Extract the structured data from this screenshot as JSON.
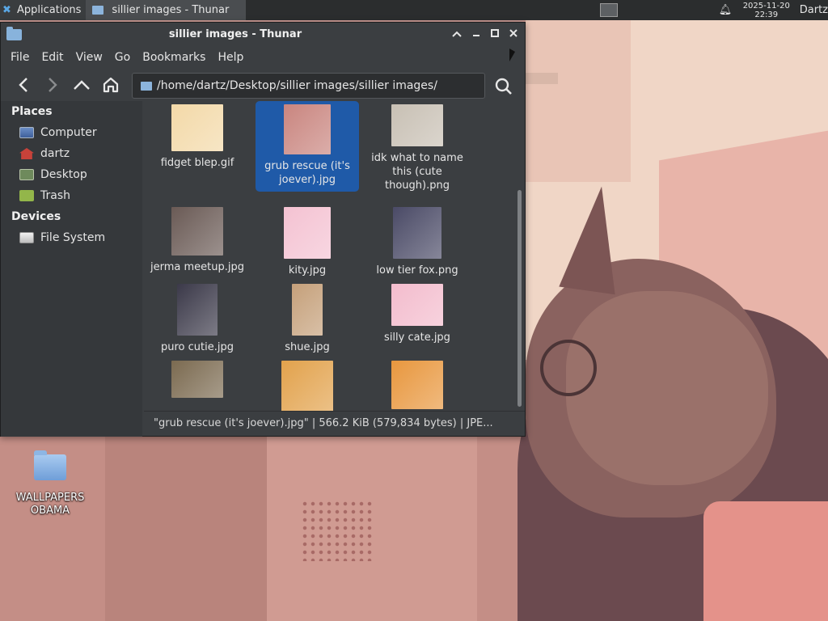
{
  "panel": {
    "apps_label": "Applications",
    "task_label": "sillier images - Thunar",
    "clock_date": "2025-11-20",
    "clock_time": "22:39",
    "user": "Dartz"
  },
  "window": {
    "title": "sillier images - Thunar",
    "menu": [
      "File",
      "Edit",
      "View",
      "Go",
      "Bookmarks",
      "Help"
    ],
    "path": "/home/dartz/Desktop/sillier images/sillier images/"
  },
  "sidebar": {
    "places_header": "Places",
    "places": [
      "Computer",
      "dartz",
      "Desktop",
      "Trash"
    ],
    "devices_header": "Devices",
    "devices": [
      "File System"
    ]
  },
  "files": [
    {
      "name": "fidget blep.gif",
      "color": "#f3d9a8",
      "selected": false
    },
    {
      "name": "grub rescue (it's joever).jpg",
      "color": "#c9857f",
      "selected": true
    },
    {
      "name": "idk what to name this (cute though).png",
      "color": "#c8c0b4",
      "selected": false
    },
    {
      "name": "jerma meetup.jpg",
      "color": "#6a5a55",
      "selected": false
    },
    {
      "name": "kity.jpg",
      "color": "#f4c2d2",
      "selected": false
    },
    {
      "name": "low tier fox.png",
      "color": "#4a4a66",
      "selected": false
    },
    {
      "name": "puro cutie.jpg",
      "color": "#3b3949",
      "selected": false
    },
    {
      "name": "shue.jpg",
      "color": "#c5a07a",
      "selected": false
    },
    {
      "name": "silly cate.jpg",
      "color": "#f3bccd",
      "selected": false
    },
    {
      "name": "",
      "color": "#7b6a50",
      "selected": false
    },
    {
      "name": "",
      "color": "#e2a24c",
      "selected": false
    },
    {
      "name": "",
      "color": "#e8973e",
      "selected": false
    }
  ],
  "status": "\"grub rescue (it's joever).jpg\"  |  566.2 KiB (579,834 bytes)  |  JPE...",
  "desktop": {
    "icon_label": "WALLPAPERS OBAMA"
  },
  "colors": {
    "selection": "#1f5aa8",
    "window_bg": "#3b3e41",
    "panel_bg": "#2b2d2e"
  }
}
